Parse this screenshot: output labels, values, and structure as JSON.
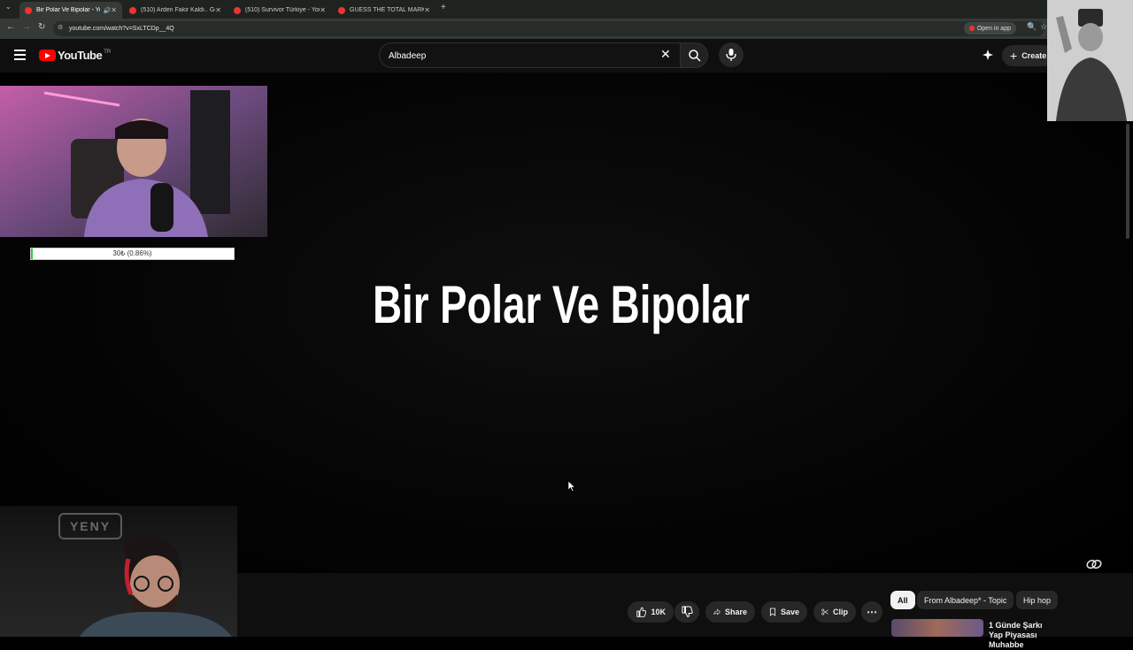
{
  "browser": {
    "tabs": [
      {
        "label": "Bir Polar Ve Bipolar - YouTube",
        "active": true
      },
      {
        "label": "(510) Arden Fakir Kaldı.. Gerçe",
        "active": false
      },
      {
        "label": "(510) Survivor Türkiye - YouTube",
        "active": false
      },
      {
        "label": "GUESS THE TOTAL MARKET VA",
        "active": false
      }
    ],
    "new_tab": "+",
    "url": "youtube.com/watch?v=SxLTCDp__4Q",
    "open_in_app": "Open in app"
  },
  "youtube": {
    "logo_word": "YouTube",
    "country_code": "TR",
    "search_value": "Albadeep",
    "create_label": "Create"
  },
  "video": {
    "title_card": "Bir Polar Ve Bipolar"
  },
  "overlay": {
    "donation_text": "30₺ (0.86%)",
    "donation_progress_pct": 0.86,
    "yeny_logo": "YENY"
  },
  "actions": {
    "likes": "10K",
    "share": "Share",
    "save": "Save",
    "clip": "Clip"
  },
  "chips": [
    "All",
    "From Albadeep* - Topic",
    "Hip hop"
  ],
  "recommendation": {
    "title": "1 Günde Şarkı Yap Piyasası Muhabbe"
  },
  "colors": {
    "accent_red": "#ff0000",
    "progress_green": "#2ecc40",
    "background": "#0f0f0f"
  }
}
